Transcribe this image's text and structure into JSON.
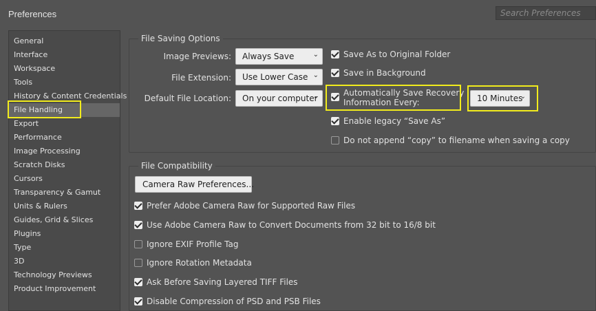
{
  "window": {
    "title": "Preferences"
  },
  "search": {
    "placeholder": "Search Preferences"
  },
  "sidebar": {
    "items": [
      {
        "label": "General"
      },
      {
        "label": "Interface"
      },
      {
        "label": "Workspace"
      },
      {
        "label": "Tools"
      },
      {
        "label": "History & Content Credentials"
      },
      {
        "label": "File Handling",
        "selected": true
      },
      {
        "label": "Export"
      },
      {
        "label": "Performance"
      },
      {
        "label": "Image Processing"
      },
      {
        "label": "Scratch Disks"
      },
      {
        "label": "Cursors"
      },
      {
        "label": "Transparency & Gamut"
      },
      {
        "label": "Units & Rulers"
      },
      {
        "label": "Guides, Grid & Slices"
      },
      {
        "label": "Plugins"
      },
      {
        "label": "Type"
      },
      {
        "label": "3D"
      },
      {
        "label": "Technology Previews"
      },
      {
        "label": "Product Improvement"
      }
    ]
  },
  "file_saving": {
    "title": "File Saving Options",
    "image_previews": {
      "label": "Image Previews:",
      "value": "Always Save"
    },
    "file_extension": {
      "label": "File Extension:",
      "value": "Use Lower Case"
    },
    "default_location": {
      "label": "Default File Location:",
      "value": "On your computer"
    },
    "checkboxes": [
      {
        "label": "Save As to Original Folder",
        "checked": true
      },
      {
        "label": "Save in Background",
        "checked": true
      },
      {
        "label": "Automatically Save Recovery",
        "label2": "Information Every:",
        "checked": true
      },
      {
        "label": "Enable legacy “Save As”",
        "checked": true
      },
      {
        "label": "Do not append “copy” to filename when saving a copy",
        "checked": false
      }
    ],
    "autosave_interval": {
      "value": "10 Minutes"
    }
  },
  "file_compat": {
    "title": "File Compatibility",
    "camera_raw_button": "Camera Raw Preferences...",
    "checkboxes": [
      {
        "label": "Prefer Adobe Camera Raw for Supported Raw Files",
        "checked": true
      },
      {
        "label": "Use Adobe Camera Raw to Convert Documents from 32 bit to 16/8 bit",
        "checked": true
      },
      {
        "label": "Ignore EXIF Profile Tag",
        "checked": false
      },
      {
        "label": "Ignore Rotation Metadata",
        "checked": false
      },
      {
        "label": "Ask Before Saving Layered TIFF Files",
        "checked": true
      },
      {
        "label": "Disable Compression of PSD and PSB Files",
        "checked": true
      }
    ]
  },
  "colors": {
    "background": "#535353",
    "panel": "#4a4a4a",
    "highlight": "#f2ec1c",
    "selected": "#666666"
  }
}
